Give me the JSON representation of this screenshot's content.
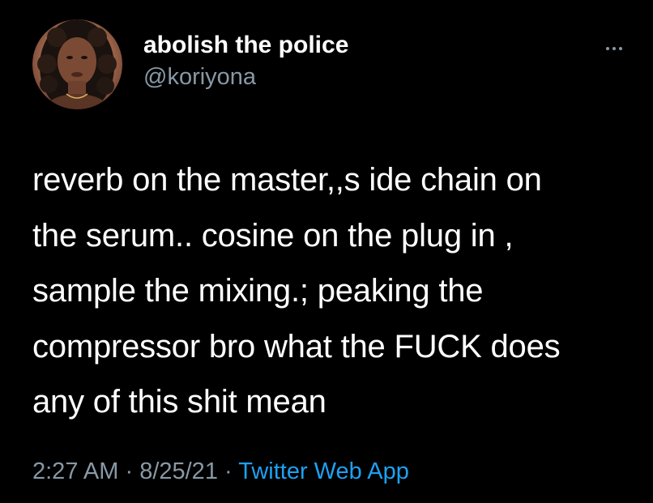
{
  "author": {
    "display_name": "abolish the police",
    "handle": "@koriyona",
    "avatar_icon": "profile-photo"
  },
  "more_icon": "more-horizontal-icon",
  "tweet": {
    "lines": [
      "reverb on the master,,s ide chain on",
      "the serum.. cosine on the plug in ,",
      "sample the mixing.; peaking the",
      "compressor bro what the FUCK does",
      "any of this shit mean"
    ]
  },
  "meta": {
    "time": "2:27 AM",
    "separator": " · ",
    "date": "8/25/21",
    "source": "Twitter Web App"
  },
  "colors": {
    "background": "#000000",
    "text": "#ffffff",
    "secondary": "#8899a6",
    "link": "#1da1f2"
  }
}
